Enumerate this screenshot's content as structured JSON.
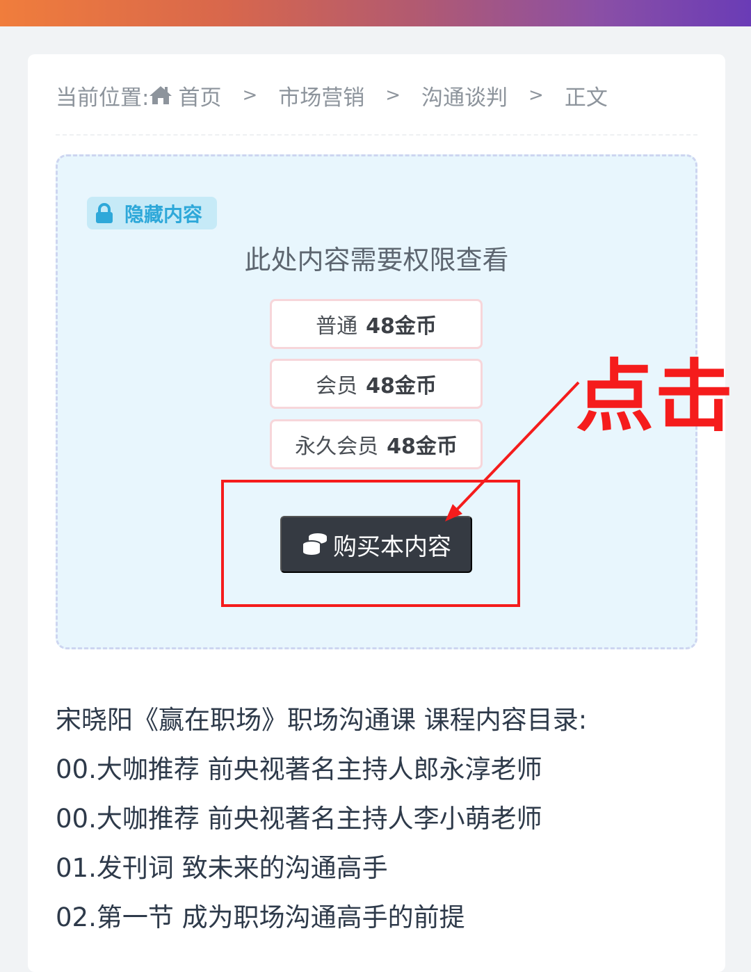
{
  "breadcrumb": {
    "prefix": "当前位置:",
    "home_icon": "home-icon",
    "home": "首页",
    "separator": ">",
    "level1": "市场营销",
    "level2": "沟通谈判",
    "current": "正文"
  },
  "hidden_content": {
    "badge_icon": "lock-icon",
    "badge_label": "隐藏内容",
    "title": "此处内容需要权限查看",
    "prices": [
      {
        "tier": "普通",
        "price": "48金币"
      },
      {
        "tier": "会员",
        "price": "48金币"
      },
      {
        "tier": "永久会员",
        "price": "48金币"
      }
    ],
    "buy_icon": "coins-icon",
    "buy_label": "购买本内容"
  },
  "annotation": {
    "text": "点击",
    "color": "#f51c1c"
  },
  "article": {
    "lines": [
      "宋晓阳《赢在职场》职场沟通课 课程内容目录:",
      "00.大咖推荐 前央视著名主持人郎永淳老师",
      "00.大咖推荐 前央视著名主持人李小萌老师",
      "01.发刊词 致未来的沟通高手",
      "02.第一节 成为职场沟通高手的前提"
    ]
  },
  "colors": {
    "badge_text": "#2ea8d9",
    "buy_button": "#353a42",
    "box_background": "#e8f6fd"
  }
}
